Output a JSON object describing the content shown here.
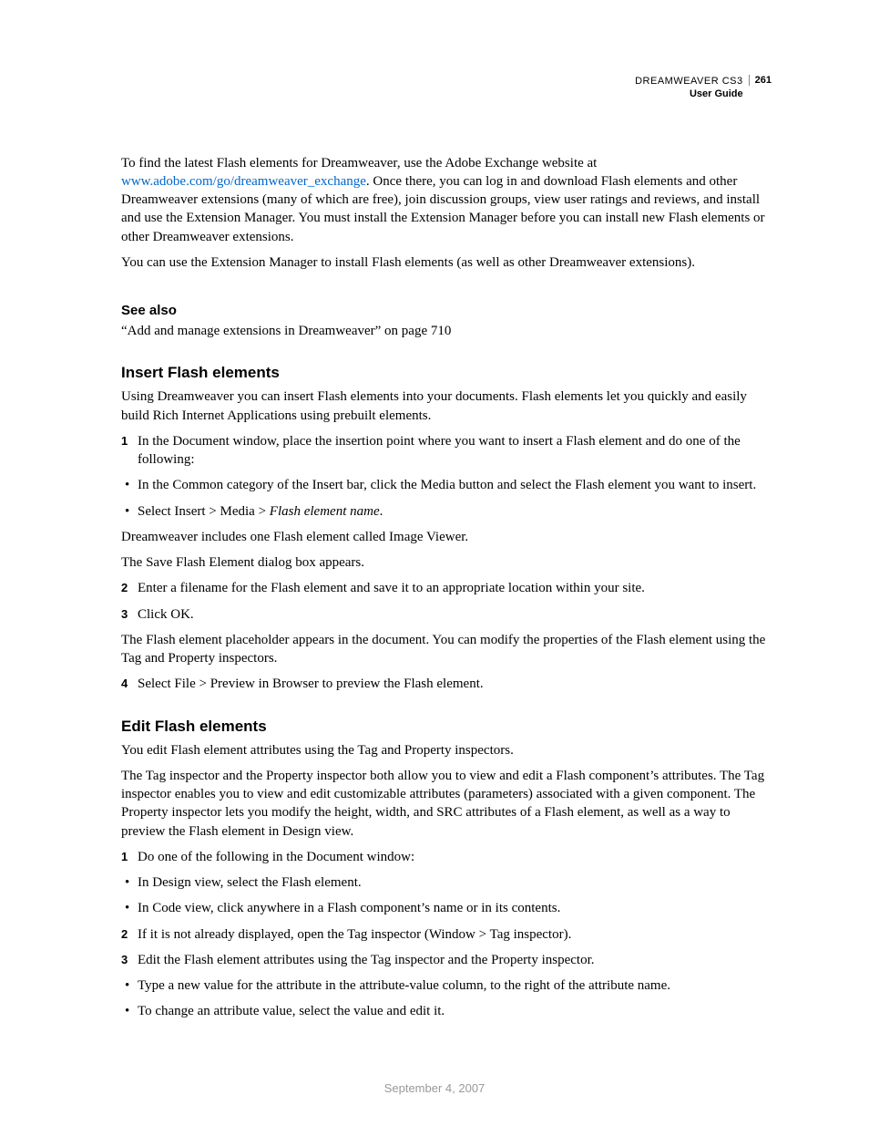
{
  "header": {
    "title": "DREAMWEAVER CS3",
    "subtitle": "User Guide",
    "page_number": "261"
  },
  "intro": {
    "p1_part1": "To find the latest Flash elements for Dreamweaver, use the Adobe Exchange website at ",
    "link": "www.adobe.com/go/dreamweaver_exchange",
    "p1_part2": ". Once there, you can log in and download Flash elements and other Dreamweaver extensions (many of which are free), join discussion groups, view user ratings and reviews, and install and use the Extension Manager. You must install the Extension Manager before you can install new Flash elements or other Dreamweaver extensions.",
    "p2": "You can use the Extension Manager to install Flash elements (as well as other Dreamweaver extensions)."
  },
  "see_also": {
    "heading": "See also",
    "line": "“Add and manage extensions in Dreamweaver” on page 710"
  },
  "insert": {
    "heading": "Insert Flash elements",
    "p1": "Using Dreamweaver you can insert Flash elements into your documents. Flash elements let you quickly and easily build Rich Internet Applications using prebuilt elements.",
    "step1": "In the Document window, place the insertion point where you want to insert a Flash element and do one of the following:",
    "bullet1": "In the Common category of the Insert bar, click the Media button and select the Flash element you want to insert.",
    "bullet2_pre": "Select Insert > Media > ",
    "bullet2_italic": "Flash element name",
    "bullet2_post": ".",
    "p2": "Dreamweaver includes one Flash element called Image Viewer.",
    "p3": "The Save Flash Element dialog box appears.",
    "step2": "Enter a filename for the Flash element and save it to an appropriate location within your site.",
    "step3": "Click OK.",
    "p4": "The Flash element placeholder appears in the document. You can modify the properties of the Flash element using the Tag and Property inspectors.",
    "step4": "Select File > Preview in Browser to preview the Flash element."
  },
  "edit": {
    "heading": "Edit Flash elements",
    "p1": "You edit Flash element attributes using the Tag and Property inspectors.",
    "p2": "The Tag inspector and the Property inspector both allow you to view and edit a Flash component’s attributes. The Tag inspector enables you to view and edit customizable attributes (parameters) associated with a given component. The Property inspector lets you modify the height, width, and SRC attributes of a Flash element, as well as a way to preview the Flash element in Design view.",
    "step1": "Do one of the following in the Document window:",
    "bullet1": "In Design view, select the Flash element.",
    "bullet2": "In Code view, click anywhere in a Flash component’s name or in its contents.",
    "step2": "If it is not already displayed, open the Tag inspector (Window > Tag inspector).",
    "step3": "Edit the Flash element attributes using the Tag inspector and the Property inspector.",
    "bullet3": "Type a new value for the attribute in the attribute-value column, to the right of the attribute name.",
    "bullet4": "To change an attribute value, select the value and edit it."
  },
  "footer": {
    "date": "September 4, 2007"
  },
  "numerals": {
    "n1": "1",
    "n2": "2",
    "n3": "3",
    "n4": "4"
  },
  "bullet": "•"
}
